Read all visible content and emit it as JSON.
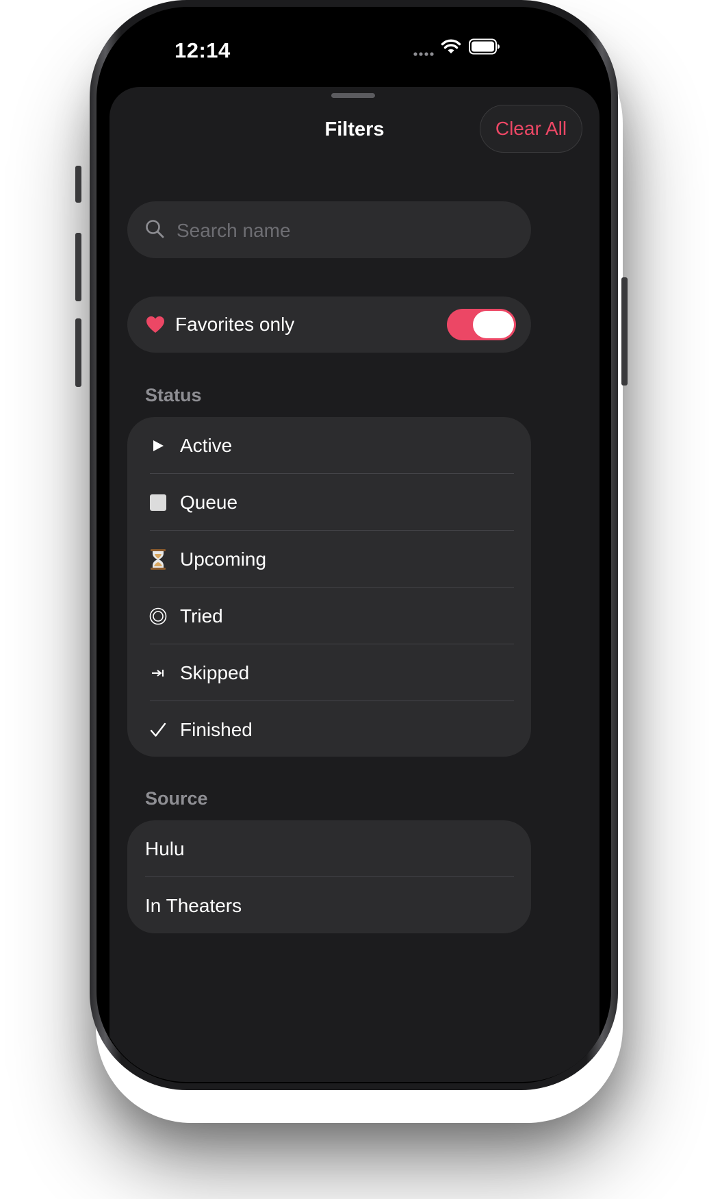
{
  "status_bar": {
    "time": "12:14"
  },
  "sheet": {
    "title": "Filters",
    "clear_all_label": "Clear All"
  },
  "search": {
    "placeholder": "Search name",
    "value": ""
  },
  "favorites": {
    "label": "Favorites only",
    "enabled": true
  },
  "status_section": {
    "header": "Status",
    "items": [
      {
        "label": "Active",
        "icon": "play-icon"
      },
      {
        "label": "Queue",
        "icon": "stop-square-icon"
      },
      {
        "label": "Upcoming",
        "icon": "hourglass-icon"
      },
      {
        "label": "Tried",
        "icon": "target-circle-icon"
      },
      {
        "label": "Skipped",
        "icon": "skip-arrow-icon"
      },
      {
        "label": "Finished",
        "icon": "checkmark-icon"
      }
    ]
  },
  "source_section": {
    "header": "Source",
    "items": [
      {
        "label": "Hulu"
      },
      {
        "label": "In Theaters"
      }
    ]
  },
  "colors": {
    "accent": "#ec4765",
    "sheet_background": "#1c1c1e",
    "row_background": "#2c2c2e",
    "secondary_text": "#8e8e93"
  }
}
